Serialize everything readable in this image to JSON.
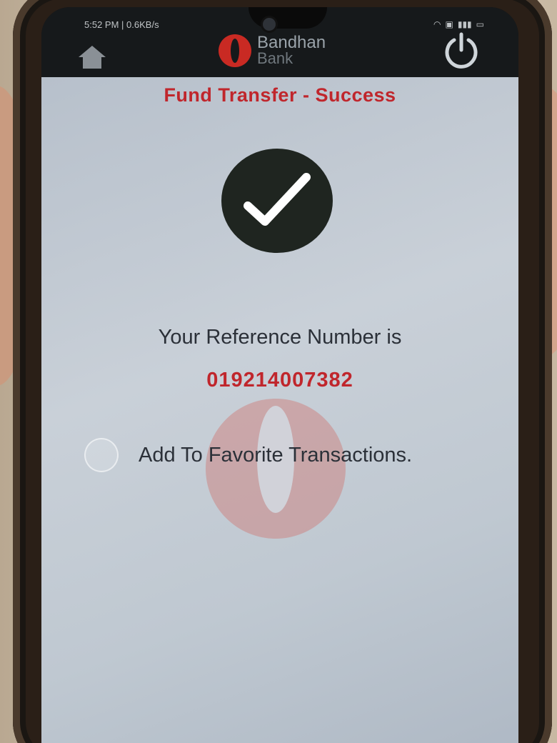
{
  "status_bar": {
    "time": "5:52 PM",
    "speed": "0.6KB/s",
    "icons": [
      "alarm-icon",
      "wifi-icon",
      "volte-icon",
      "signal-icon",
      "battery-icon"
    ]
  },
  "header": {
    "brand_name": "Bandhan",
    "brand_sub": "Bank",
    "home_icon": "home-icon",
    "power_icon": "power-icon"
  },
  "page": {
    "title": "Fund Transfer - Success",
    "success_icon": "check-icon",
    "reference_label": "Your Reference Number is",
    "reference_number": "019214007382",
    "favorite_label": "Add To Favorite Transactions."
  },
  "colors": {
    "accent_red": "#c0262c",
    "header_bg": "#16191b",
    "text_dark": "#2b3038"
  }
}
